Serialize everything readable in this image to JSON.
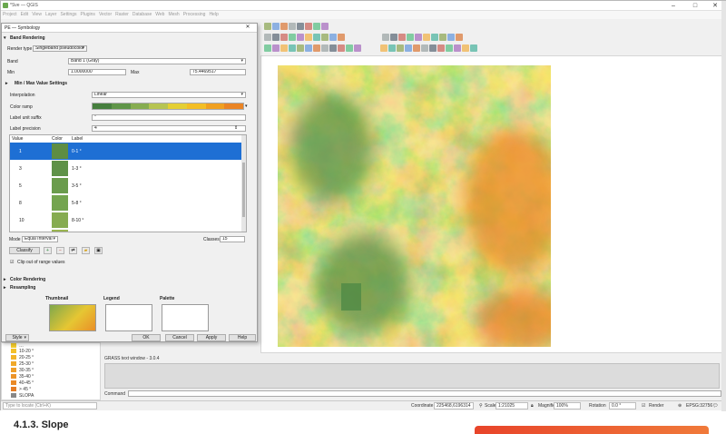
{
  "window": {
    "title": "*Sve — QGIS"
  },
  "menu": [
    "Project",
    "Edit",
    "View",
    "Layer",
    "Settings",
    "Plugins",
    "Vector",
    "Raster",
    "Database",
    "Web",
    "Mesh",
    "Processing",
    "Help"
  ],
  "dialog": {
    "title": "PE — Symbology",
    "band_rendering": "Band Rendering",
    "render_type_label": "Render type",
    "render_type": "Singleband pseudocolor",
    "band_label": "Band",
    "band": "Band 1 (Gray)",
    "min_label": "Min",
    "min": "1.0000000",
    "max_label": "Max",
    "max": "75.4469517",
    "minmax_settings": "Min / Max Value Settings",
    "interpolation_label": "Interpolation",
    "interpolation": "Linear",
    "color_ramp_label": "Color ramp",
    "label_unit_suffix_label": "Label unit suffix",
    "label_unit_suffix": "°",
    "label_precision_label": "Label precision",
    "label_precision": "4",
    "table_headers": [
      "Value",
      "Color",
      "Label"
    ],
    "rows": [
      {
        "value": "1",
        "label": "0-1 °",
        "color": "#5e8d44"
      },
      {
        "value": "3",
        "label": "1-3 °",
        "color": "#5f9248"
      },
      {
        "value": "5",
        "label": "3-5 °",
        "color": "#6a9c4c"
      },
      {
        "value": "8",
        "label": "5-8 °",
        "color": "#74a54f"
      },
      {
        "value": "10",
        "label": "8-10 °",
        "color": "#86ac50"
      }
    ],
    "mode_label": "Mode",
    "mode": "Equal Interval",
    "classes_label": "Classes",
    "classes": "15",
    "classify": "Classify",
    "clip_label": "Clip out of range values",
    "color_rendering": "Color Rendering",
    "resampling": "Resampling",
    "thumbnail": "Thumbnail",
    "legend": "Legend",
    "palette": "Palette",
    "style": "Style",
    "ok": "OK",
    "cancel": "Cancel",
    "apply": "Apply",
    "help": "Help"
  },
  "ramp_colors": [
    "#467f3e",
    "#5f9548",
    "#86ad50",
    "#b6c451",
    "#e4cf33",
    "#f3be24",
    "#f0a020",
    "#ea8424"
  ],
  "layers": [
    {
      "label": "10-20 °",
      "color": "#f3c02a"
    },
    {
      "label": "20-25 °",
      "color": "#f2b42a"
    },
    {
      "label": "25-30 °",
      "color": "#f0a92a"
    },
    {
      "label": "30-35 °",
      "color": "#ef9f29"
    },
    {
      "label": "35-40 °",
      "color": "#ec9428"
    },
    {
      "label": "40-45 °",
      "color": "#ea8a28"
    },
    {
      "label": "> 45 °",
      "color": "#e57d25"
    },
    {
      "label": "SLOPA",
      "color": "#888888"
    }
  ],
  "grass": {
    "title": "GRASS text window - 3.0.4",
    "command": "Command"
  },
  "status": {
    "locate_placeholder": "Type to locate (Ctrl+K)",
    "coordinate_label": "Coordinate",
    "coordinate": "225468,6196314",
    "scale_label": "Scale",
    "scale": "1:21025",
    "magnifier_label": "Magnifier",
    "magnifier": "100%",
    "rotation_label": "Rotation",
    "rotation": "0.0 °",
    "render_label": "Render",
    "crs": "EPSG:32756"
  },
  "caption": "4.1.3. Slope"
}
